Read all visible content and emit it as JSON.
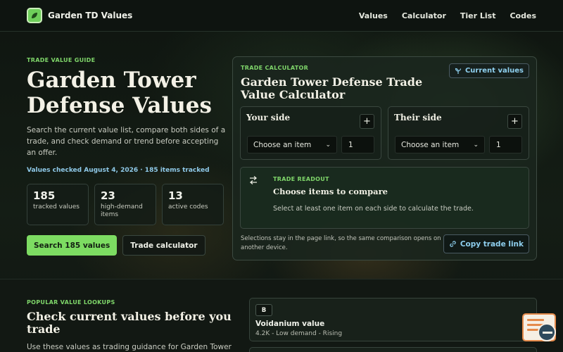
{
  "header": {
    "brand": "Garden TD Values",
    "nav": [
      "Values",
      "Calculator",
      "Tier List",
      "Codes"
    ]
  },
  "hero": {
    "eyebrow": "TRADE VALUE GUIDE",
    "title": "Garden Tower Defense Values",
    "description": "Search the current value list, compare both sides of a trade, and check demand or trend before accepting an offer.",
    "meta": "Values checked August 4, 2026 · 185 items tracked",
    "stats": [
      {
        "value": "185",
        "label": "tracked values"
      },
      {
        "value": "23",
        "label": "high-demand items"
      },
      {
        "value": "13",
        "label": "active codes"
      }
    ],
    "primary_cta": "Search 185 values",
    "secondary_cta": "Trade calculator"
  },
  "calculator": {
    "eyebrow": "TRADE CALCULATOR",
    "title": "Garden Tower Defense Trade Value Calculator",
    "current_values_label": "Current values",
    "your_side": {
      "title": "Your side",
      "add": "+",
      "select": "Choose an item",
      "qty": "1"
    },
    "their_side": {
      "title": "Their side",
      "add": "+",
      "select": "Choose an item",
      "qty": "1"
    },
    "readout": {
      "eyebrow": "TRADE READOUT",
      "title": "Choose items to compare",
      "text": "Select at least one item on each side to calculate the trade."
    },
    "note": "Selections stay in the page link, so the same comparison opens on another device.",
    "copy_label": "Copy trade link"
  },
  "lower": {
    "eyebrow": "POPULAR VALUE LOOKUPS",
    "title": "Check current values before you trade",
    "description": "Use these values as trading guidance for Garden Tower",
    "items": [
      {
        "tier": "B",
        "name": "Voidanium value",
        "meta": "4.2K - Low demand - Rising"
      }
    ]
  },
  "colors": {
    "accent_green": "#7ddc62",
    "accent_blue": "#8ecfee"
  }
}
